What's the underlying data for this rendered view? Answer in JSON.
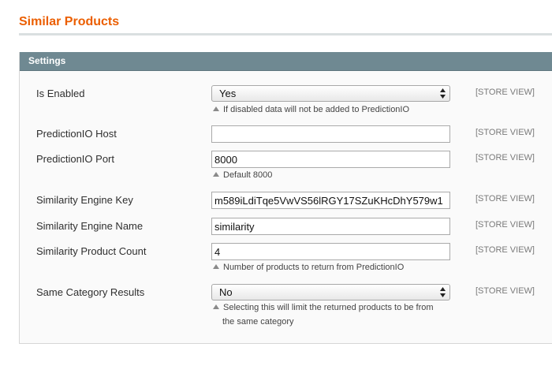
{
  "page": {
    "title": "Similar Products"
  },
  "settings": {
    "header": "Settings",
    "scope_label": "[STORE VIEW]",
    "fields": [
      {
        "label": "Is Enabled",
        "type": "select",
        "value": "Yes",
        "note": "If disabled data will not be added to PredictionIO"
      },
      {
        "label": "PredictionIO Host",
        "type": "text",
        "value": ""
      },
      {
        "label": "PredictionIO Port",
        "type": "text",
        "value": "8000",
        "note": "Default 8000"
      },
      {
        "label": "Similarity Engine Key",
        "type": "text",
        "value": "m589iLdiTqe5VwVS56lRGY17SZuKHcDhY579w1"
      },
      {
        "label": "Similarity Engine Name",
        "type": "text",
        "value": "similarity"
      },
      {
        "label": "Similarity Product Count",
        "type": "text",
        "value": "4",
        "note": "Number of products to return from PredictionIO"
      },
      {
        "label": "Same Category Results",
        "type": "select",
        "value": "No",
        "note_line1": "Selecting this will limit the returned products to be from",
        "note_line2": "the same category"
      }
    ]
  },
  "icons": {
    "select_arrows": "up-down-arrows-icon",
    "note_marker": "triangle-up-icon"
  }
}
